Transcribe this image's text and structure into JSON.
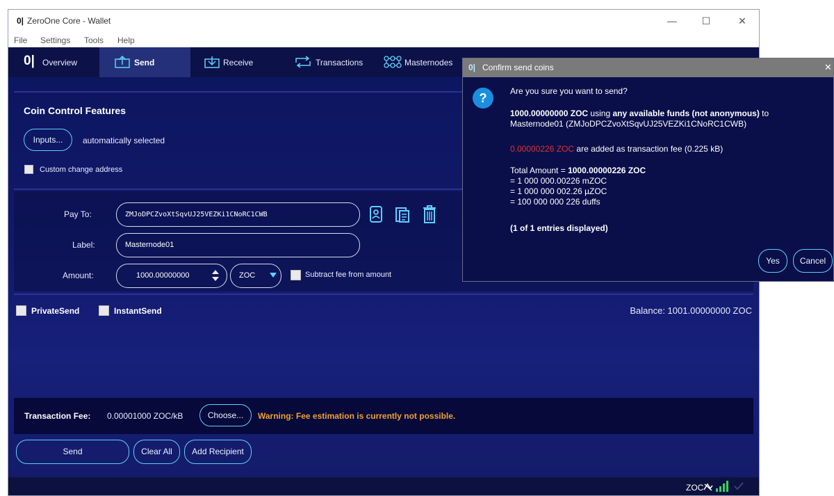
{
  "window": {
    "logo": "0|",
    "title": "ZeroOne Core - Wallet",
    "minimize": "—",
    "maximize": "☐",
    "close": "✕"
  },
  "menu": [
    "File",
    "Settings",
    "Tools",
    "Help"
  ],
  "tabs": [
    {
      "label": "Overview",
      "icon": "logo-icon"
    },
    {
      "label": "Send",
      "icon": "send-icon"
    },
    {
      "label": "Receive",
      "icon": "receive-icon"
    },
    {
      "label": "Transactions",
      "icon": "transactions-icon"
    },
    {
      "label": "Masternodes",
      "icon": "masternodes-icon"
    }
  ],
  "coin_control": {
    "title": "Coin Control Features",
    "inputs_button": "Inputs...",
    "selection": "automatically selected",
    "custom_change": "Custom change address"
  },
  "recipient": {
    "pay_to_label": "Pay To:",
    "pay_to_value": "ZMJoDPCZvoXtSqvUJ25VEZKi1CNoRC1CWB",
    "label_label": "Label:",
    "label_value": "Masternode01",
    "amount_label": "Amount:",
    "amount_value": "1000.00000000",
    "unit": "ZOC",
    "subtract_fee": "Subtract fee from amount"
  },
  "options": {
    "privatesend": "PrivateSend",
    "instantsend": "InstantSend",
    "balance": "Balance: 1001.00000000 ZOC"
  },
  "fee": {
    "label": "Transaction Fee:",
    "value": "0.00001000 ZOC/kB",
    "choose_button": "Choose...",
    "warning": "Warning: Fee estimation is currently not possible."
  },
  "actions": {
    "send": "Send",
    "clear_all": "Clear All",
    "add_recipient": "Add Recipient"
  },
  "status": {
    "unit": "ZOC"
  },
  "dialog": {
    "logo": "0|",
    "title": "Confirm send coins",
    "close": "✕",
    "question": "Are you sure you want to send?",
    "amount_bold": "1000.00000000 ZOC",
    "using": " using ",
    "funds_bold": "any available funds (not anonymous)",
    "to": " to",
    "destination": "Masternode01 (ZMJoDPCZvoXtSqvUJ25VEZKi1CNoRC1CWB)",
    "fee_amount": "0.00000226 ZOC",
    "fee_text": " are added as transaction fee (0.225 kB)",
    "total_prefix": "Total Amount = ",
    "total_bold": "1000.00000226 ZOC",
    "eq_mzoc": "= 1 000 000.00226 mZOC",
    "eq_uzoc": "= 1 000 000 002.26 µZOC",
    "eq_duffs": "= 100 000 000 226 duffs",
    "entries": "(1 of 1 entries displayed)",
    "yes": "Yes",
    "cancel": "Cancel"
  },
  "colors": {
    "accent": "#5fd0ff",
    "warning": "#f0a030",
    "fee_red": "#e03030",
    "background": "#0a0f4a"
  }
}
